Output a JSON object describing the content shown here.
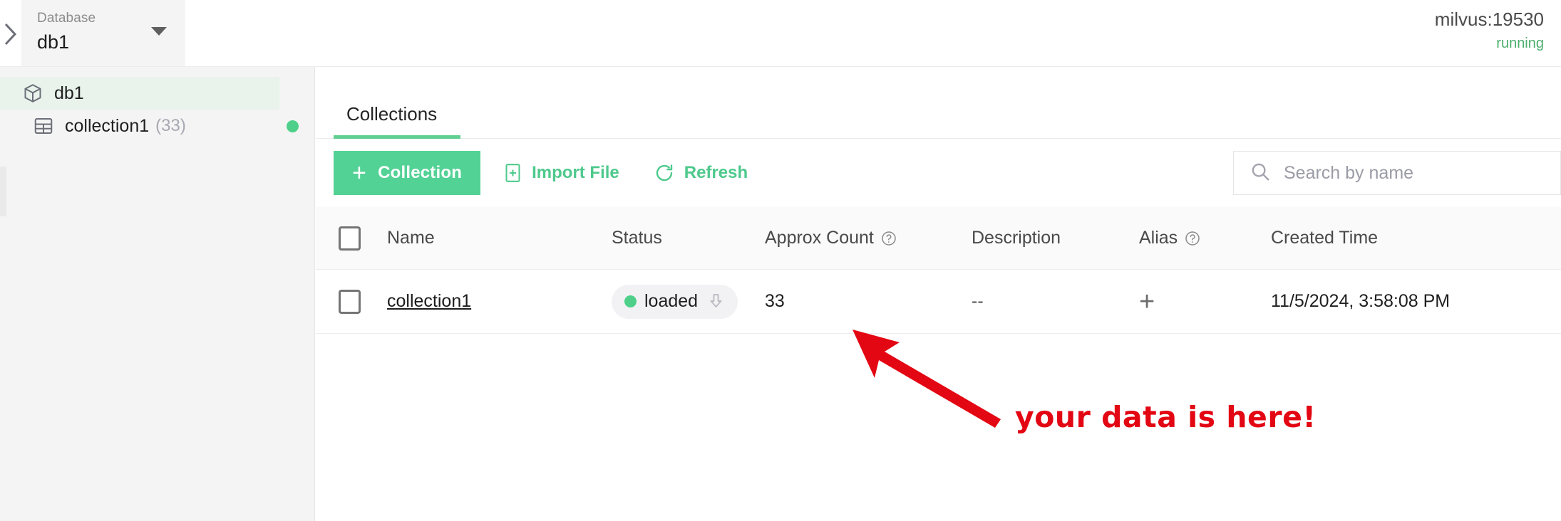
{
  "topbar": {
    "collapse_icon": "chevron-right-icon",
    "database_picker": {
      "label": "Database",
      "value": "db1",
      "caret_icon": "caret-down-icon"
    },
    "connection": {
      "name": "milvus:19530",
      "status": "running",
      "status_color": "#4caf6d"
    }
  },
  "sidebar": {
    "tree": [
      {
        "icon": "database-cube-icon",
        "label": "db1",
        "count": "",
        "selected": true,
        "has_status_dot": false
      },
      {
        "icon": "table-grid-icon",
        "label": "collection1",
        "count": "(33)",
        "selected": false,
        "has_status_dot": true,
        "status_dot_color": "#4ed08a"
      }
    ]
  },
  "content": {
    "tabs": [
      {
        "label": "Collections",
        "active": true
      }
    ],
    "toolbar": {
      "create_label": "Collection",
      "create_icon": "plus-icon",
      "import_label": "Import File",
      "import_icon": "file-plus-icon",
      "refresh_label": "Refresh",
      "refresh_icon": "refresh-icon",
      "accent_color": "#53d295"
    },
    "search": {
      "placeholder": "Search by name",
      "icon": "search-icon"
    },
    "table": {
      "columns": [
        {
          "key": "check",
          "label": "",
          "help": false
        },
        {
          "key": "name",
          "label": "Name",
          "help": false
        },
        {
          "key": "status",
          "label": "Status",
          "help": false
        },
        {
          "key": "count",
          "label": "Approx Count",
          "help": true
        },
        {
          "key": "description",
          "label": "Description",
          "help": false
        },
        {
          "key": "alias",
          "label": "Alias",
          "help": true
        },
        {
          "key": "created",
          "label": "Created Time",
          "help": false
        }
      ],
      "rows": [
        {
          "name": "collection1",
          "status": "loaded",
          "status_dot_color": "#4ed08a",
          "status_action_icon": "release-download-icon",
          "count": "33",
          "description": "--",
          "alias": "+",
          "created": "11/5/2024, 3:58:08 PM"
        }
      ]
    }
  },
  "annotation": {
    "text": "your data is here!",
    "color": "#e30613",
    "arrow": "red-arrow-up-left"
  }
}
